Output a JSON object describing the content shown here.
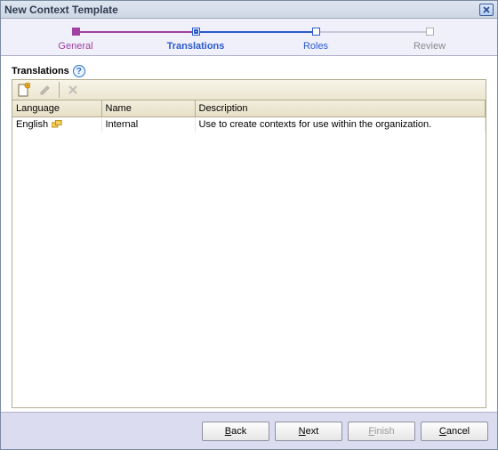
{
  "window": {
    "title": "New Context Template"
  },
  "wizard": {
    "steps": [
      {
        "label": "General",
        "color": "#a040a0",
        "current": false
      },
      {
        "label": "Translations",
        "color": "#2a5acc",
        "current": true
      },
      {
        "label": "Roles",
        "color": "#2a5acc",
        "current": false
      },
      {
        "label": "Review",
        "color": "#a0a0a0",
        "current": false
      }
    ]
  },
  "section": {
    "title": "Translations"
  },
  "toolbar": {
    "new_enabled": true,
    "edit_enabled": false,
    "delete_enabled": false
  },
  "table": {
    "columns": [
      "Language",
      "Name",
      "Description"
    ],
    "rows": [
      {
        "language": "English",
        "is_master": true,
        "name": "Internal",
        "description": "Use to create contexts for use within the organization."
      }
    ]
  },
  "footer": {
    "back": "Back",
    "next": "Next",
    "finish": "Finish",
    "cancel": "Cancel",
    "finish_enabled": false
  }
}
